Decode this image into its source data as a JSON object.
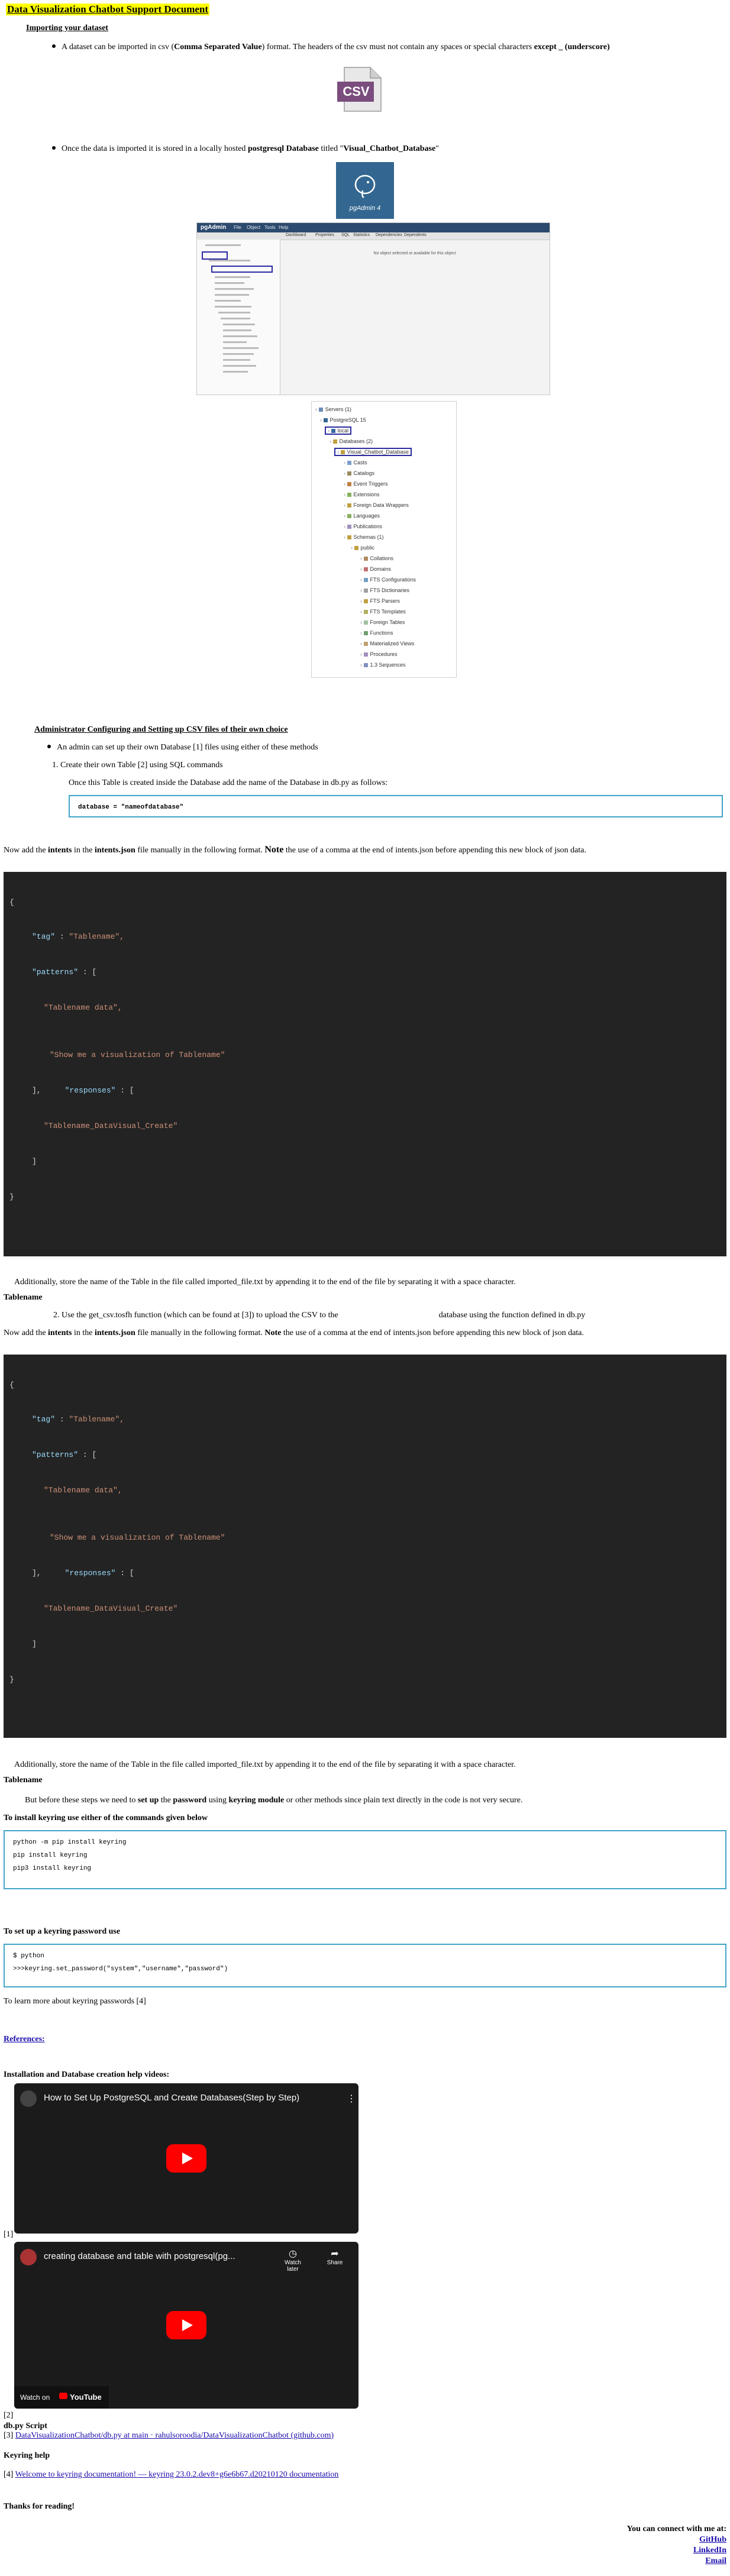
{
  "doc": {
    "title": "Data Visualization Chatbot Support Document",
    "importing_heading": "Importing your dataset",
    "bullet1": {
      "pre": "A dataset can be imported in csv (",
      "bold1": "Comma Separated Value",
      "mid": ") format. The headers of the csv must not contain any spaces or special characters ",
      "bold2": "except _ (underscore)"
    },
    "csv_icon_text": "CSV",
    "bullet2": {
      "pre": "Once the data is imported it is stored in a locally hosted ",
      "bold1": "postgresql Database",
      "mid": " titled \"",
      "bold2": "Visual_Chatbot_Database",
      "post": "\""
    },
    "pgadmin_label": "pgAdmin 4",
    "pgadmin_shot": {
      "brand": "pgAdmin",
      "menus": [
        "File",
        "Object",
        "Tools",
        "Help"
      ],
      "tabs": [
        "Dashboard",
        "Properties",
        "SQL",
        "Statistics",
        "Dependencies",
        "Dependents"
      ],
      "notice": "No object selected or available for this object"
    },
    "tree": [
      "Servers (1)",
      "PostgreSQL 15",
      "local",
      "Databases (2)",
      "Visual_Chatbot_Database",
      "Casts",
      "Catalogs",
      "Event Triggers",
      "Extensions",
      "Foreign Data Wrappers",
      "Languages",
      "Publications",
      "Schemas (1)",
      "public",
      "Collations",
      "Domains",
      "FTS Configurations",
      "FTS Dictionaries",
      "FTS Parsers",
      "FTS Templates",
      "Foreign Tables",
      "Functions",
      "Materialized Views",
      "Procedures",
      "1.3 Sequences"
    ],
    "admin_heading": "Administrator Configuring and Setting up CSV files of their own choice",
    "admin_bullet": "An admin can set up their own Database [1] files using either of these methods",
    "step1": "Create their own Table [2] using SQL commands",
    "step1_note": "Once this Table is created inside the Database add the name of the Database in db.py as follows:",
    "db_code": "database = \"nameofdatabase\"",
    "intents_note": {
      "pre": "Now add the ",
      "b1": "intents",
      "m1": " in the ",
      "b2": "intents.json",
      "m2": " file manually in the following format. ",
      "b3": "Note",
      "post": " the use of a comma at the end of intents.json before appending this new block of json data."
    },
    "json_block": {
      "open": "{",
      "tag_key": "\"tag\"",
      "tag_val": "\"Tablename\",",
      "patterns_key": "\"patterns\"",
      "patterns_open": " : [",
      "pattern1": "\"Tablename data\",",
      "pattern2": "\"Show me a visualization of Tablename\"",
      "close_list": "],",
      "responses_key": "\"responses\"",
      "responses_open": " : [",
      "response1": "\"Tablename_DataVisual_Create\"",
      "close_resp": "]",
      "close": "}",
      "colon": " : "
    },
    "store_note": "Additionally, store the name of the Table in the file called imported_file.txt by appending it to the end of the file by separating it with a space character.",
    "tablename_label": "Tablename",
    "step2": "2. Use the get_csv.tosfh function (which can be found at [3]) to upload the CSV to the",
    "step2_tail": "database using the function defined in db.py",
    "intents_note2": {
      "pre": " Now add the ",
      "b1": "intents",
      "m1": " in the ",
      "b2": "intents.json",
      "m2": " file manually in the following format. ",
      "b3": "Note",
      "post": " the use of a comma at the end of intents.json before appending this new block of json data."
    },
    "keyring_para": {
      "pre": "But before these steps we need to ",
      "b1": "set up",
      "m1": " the ",
      "b2": "password",
      "m2": " using ",
      "b3": "keyring module",
      "post": " or other methods since plain text directly in the code is not very secure."
    },
    "install_heading": "To install keyring use either of the commands given below",
    "install_cmds": [
      "python -m pip install keyring",
      "pip install keyring",
      "pip3 install keyring"
    ],
    "setpw_heading": "To set up a keyring password use",
    "setpw_cmds": [
      "$ python",
      ">>>keyring.set_password(\"system\",\"username\",\"password\")"
    ],
    "learn_more": "To learn more about keyring passwords [4]",
    "references": "References:",
    "install_videos_heading": "Installation and Database creation help videos:",
    "video1_title": "How to Set Up PostgreSQL and Create Databases(Step by Step)",
    "ref1": "[1]",
    "video2_title": "creating database and table with postgresql(pg...",
    "watch_later": "Watch later",
    "share": "Share",
    "watch_on": "Watch on",
    "youtube": "YouTube",
    "ref2": "[2]",
    "dbpy_heading": "db.py Script",
    "ref3_prefix": "[3] ",
    "ref3_link": "DataVisualizationChatbot/db.py at main · rahulsoroodia/DataVisualizationChatbot (github.com)",
    "keyring_help": "Keyring help",
    "ref4_prefix": "[4] ",
    "ref4_link": "Welcome to keyring documentation! — keyring 23.0.2.dev8+g6e6b67.d20210120 documentation",
    "thanks": "Thanks for reading!",
    "connect": "You can connect with me at:",
    "links": [
      "GitHub",
      "LinkedIn",
      "Email"
    ]
  }
}
